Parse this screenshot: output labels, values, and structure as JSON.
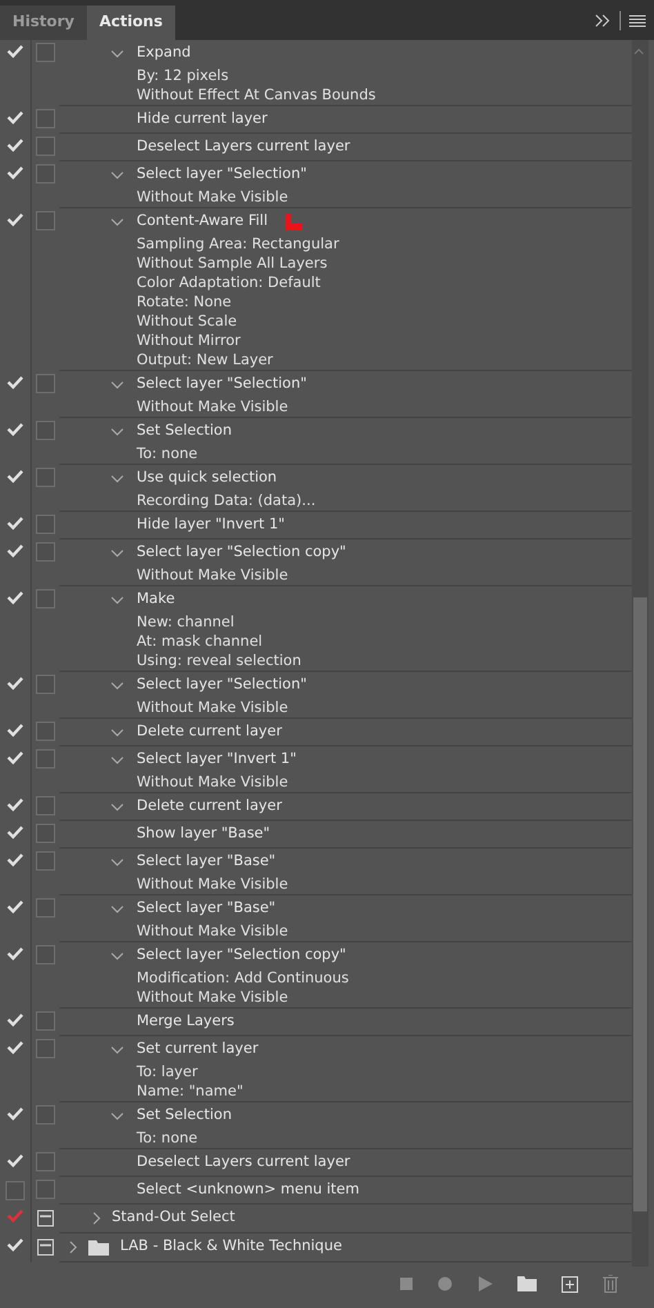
{
  "tabs": [
    {
      "label": "History",
      "selected": false
    },
    {
      "label": "Actions",
      "selected": true
    }
  ],
  "steps": [
    {
      "checked": true,
      "dialog": false,
      "expanded": true,
      "title": "Expand",
      "params": [
        "By:  12 pixels",
        "Without Effect At Canvas Bounds"
      ]
    },
    {
      "checked": true,
      "dialog": false,
      "title": "Hide current layer"
    },
    {
      "checked": true,
      "dialog": false,
      "title": "Deselect Layers current layer"
    },
    {
      "checked": true,
      "dialog": false,
      "expanded": true,
      "title": "Select layer \"Selection\"",
      "params": [
        "Without Make Visible"
      ]
    },
    {
      "checked": true,
      "dialog": false,
      "expanded": true,
      "title": "Content-Aware Fill",
      "marked": true,
      "params": [
        "Sampling Area: Rectangular",
        "Without Sample All Layers",
        "Color Adaptation: Default",
        "Rotate: None",
        "Without Scale",
        "Without Mirror",
        "Output: New Layer"
      ]
    },
    {
      "checked": true,
      "dialog": false,
      "expanded": true,
      "title": "Select layer \"Selection\"",
      "params": [
        "Without Make Visible"
      ]
    },
    {
      "checked": true,
      "dialog": false,
      "expanded": true,
      "title": "Set Selection",
      "params": [
        "To: none"
      ]
    },
    {
      "checked": true,
      "dialog": false,
      "expanded": true,
      "title": "Use quick selection",
      "params": [
        "Recording Data: (data)..."
      ]
    },
    {
      "checked": true,
      "dialog": false,
      "title": "Hide layer \"Invert 1\""
    },
    {
      "checked": true,
      "dialog": false,
      "expanded": true,
      "title": "Select layer \"Selection copy\"",
      "params": [
        "Without Make Visible"
      ]
    },
    {
      "checked": true,
      "dialog": false,
      "expanded": true,
      "title": "Make",
      "params": [
        "New: channel",
        "At: mask channel",
        "Using: reveal selection"
      ]
    },
    {
      "checked": true,
      "dialog": false,
      "expanded": true,
      "title": "Select layer \"Selection\"",
      "params": [
        "Without Make Visible"
      ]
    },
    {
      "checked": true,
      "dialog": false,
      "expanded": true,
      "title": "Delete current layer"
    },
    {
      "checked": true,
      "dialog": false,
      "expanded": true,
      "title": "Select layer \"Invert 1\"",
      "params": [
        "Without Make Visible"
      ]
    },
    {
      "checked": true,
      "dialog": false,
      "expanded": true,
      "title": "Delete current layer"
    },
    {
      "checked": true,
      "dialog": false,
      "title": "Show layer \"Base\""
    },
    {
      "checked": true,
      "dialog": false,
      "expanded": true,
      "title": "Select layer \"Base\"",
      "params": [
        "Without Make Visible"
      ]
    },
    {
      "checked": true,
      "dialog": false,
      "expanded": true,
      "title": "Select layer \"Base\"",
      "params": [
        "Without Make Visible"
      ]
    },
    {
      "checked": true,
      "dialog": false,
      "expanded": true,
      "title": "Select layer \"Selection copy\"",
      "params": [
        "Modification: Add Continuous",
        "Without Make Visible"
      ]
    },
    {
      "checked": true,
      "dialog": false,
      "title": "Merge Layers"
    },
    {
      "checked": true,
      "dialog": false,
      "expanded": true,
      "title": "Set current layer",
      "params": [
        "To: layer",
        "Name:  \"name\""
      ]
    },
    {
      "checked": true,
      "dialog": false,
      "expanded": true,
      "title": "Set Selection",
      "params": [
        "To: none"
      ]
    },
    {
      "checked": true,
      "dialog": false,
      "title": "Deselect Layers current layer"
    },
    {
      "checked": false,
      "dialog": false,
      "title": "Select <unknown> menu item"
    }
  ],
  "sets": [
    {
      "checked": true,
      "partial": true,
      "dialog": true,
      "expanded": false,
      "kind": "action",
      "title": "Stand-Out Select"
    },
    {
      "checked": true,
      "partial": false,
      "dialog": true,
      "expanded": false,
      "kind": "set",
      "title": "LAB - Black & White Technique"
    }
  ]
}
